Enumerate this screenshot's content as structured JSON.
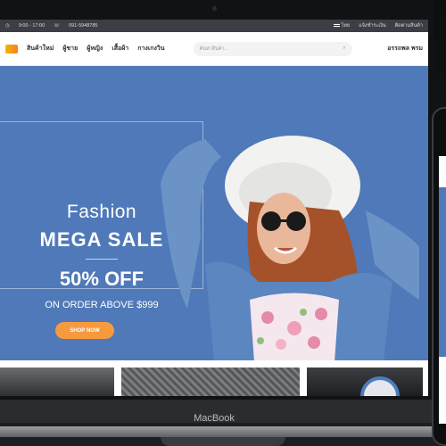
{
  "topbar": {
    "hours": "9:00 - 17:00",
    "phone": "091-5948785",
    "language": "ไทย",
    "link1": "แจ้งชำระเงิน",
    "link2": "ติดตามสินค้า"
  },
  "nav": {
    "items": [
      "สินค้าใหม่",
      "ผู้ชาย",
      "ผู้หญิง",
      "เสื้อผ้า",
      "กางเกงวิน"
    ],
    "search_placeholder": "ค้นหาสินค้า...",
    "user_label": "อรรถพล พรม"
  },
  "hero": {
    "line1": "Fashion",
    "line2": "MEGA SALE",
    "line3": "50% OFF",
    "line4": "ON ORDER ABOVE $999",
    "button": "SHOP NOW",
    "slide_count": 2,
    "active_slide": 1
  },
  "laptop_brand": "MacBook",
  "colors": {
    "hero_bg": "#4f79b8",
    "button": "#f79a3e",
    "topbar": "#3b3f45"
  }
}
